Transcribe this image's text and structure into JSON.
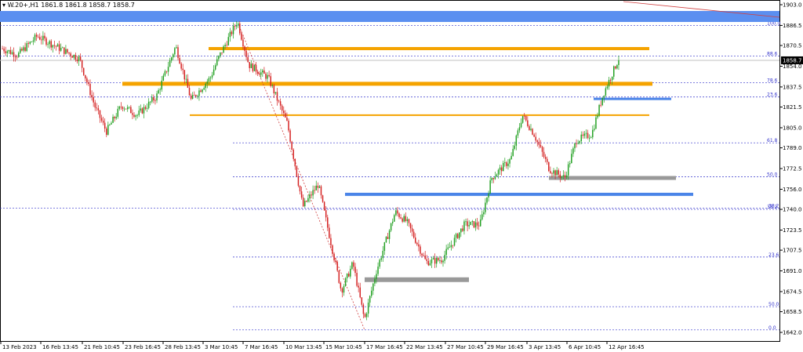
{
  "header": {
    "symbol": "W.20+,H1",
    "ohlc": "1861.8 1861.8 1858.7 1858.7"
  },
  "chart_data": {
    "type": "candlestick",
    "ylim": [
      1642.0,
      1903.0
    ],
    "price_ticks": [
      1903.0,
      1886.5,
      1870.5,
      1854.0,
      1837.5,
      1821.5,
      1805.0,
      1789.0,
      1772.5,
      1756.0,
      1740.0,
      1723.5,
      1707.5,
      1691.0,
      1674.5,
      1658.5,
      1642.0
    ],
    "time_labels": [
      "13 Feb 2023",
      "16 Feb 13:45",
      "21 Feb 10:45",
      "23 Feb 16:45",
      "28 Feb 13:45",
      "3 Mar 10:45",
      "7 Mar 16:45",
      "10 Mar 13:45",
      "15 Mar 10:45",
      "17 Mar 16:45",
      "22 Mar 13:45",
      "27 Mar 10:45",
      "29 Mar 16:45",
      "3 Apr 13:45",
      "6 Apr 10:45",
      "12 Apr 16:45"
    ],
    "current_price": "1858.7",
    "fib_levels_1": [
      "100.0",
      "88.6",
      "78.6",
      "23.6",
      "61.8",
      "50.0",
      "38.2"
    ],
    "fib_levels_2": [
      "38.2",
      "23.6",
      "50.0",
      "0.0"
    ],
    "path": [
      {
        "t": 0,
        "p": 1868
      },
      {
        "t": 0.02,
        "p": 1863
      },
      {
        "t": 0.045,
        "p": 1878
      },
      {
        "t": 0.075,
        "p": 1868
      },
      {
        "t": 0.1,
        "p": 1860
      },
      {
        "t": 0.12,
        "p": 1822
      },
      {
        "t": 0.135,
        "p": 1802
      },
      {
        "t": 0.155,
        "p": 1823
      },
      {
        "t": 0.175,
        "p": 1815
      },
      {
        "t": 0.2,
        "p": 1830
      },
      {
        "t": 0.225,
        "p": 1870
      },
      {
        "t": 0.245,
        "p": 1827
      },
      {
        "t": 0.27,
        "p": 1845
      },
      {
        "t": 0.28,
        "p": 1860
      },
      {
        "t": 0.305,
        "p": 1890
      },
      {
        "t": 0.32,
        "p": 1855
      },
      {
        "t": 0.345,
        "p": 1845
      },
      {
        "t": 0.37,
        "p": 1808
      },
      {
        "t": 0.39,
        "p": 1742
      },
      {
        "t": 0.41,
        "p": 1760
      },
      {
        "t": 0.44,
        "p": 1675
      },
      {
        "t": 0.455,
        "p": 1697
      },
      {
        "t": 0.47,
        "p": 1652
      },
      {
        "t": 0.485,
        "p": 1690
      },
      {
        "t": 0.51,
        "p": 1738
      },
      {
        "t": 0.525,
        "p": 1730
      },
      {
        "t": 0.55,
        "p": 1698
      },
      {
        "t": 0.57,
        "p": 1700
      },
      {
        "t": 0.6,
        "p": 1728
      },
      {
        "t": 0.62,
        "p": 1728
      },
      {
        "t": 0.635,
        "p": 1765
      },
      {
        "t": 0.66,
        "p": 1780
      },
      {
        "t": 0.675,
        "p": 1815
      },
      {
        "t": 0.69,
        "p": 1800
      },
      {
        "t": 0.71,
        "p": 1772
      },
      {
        "t": 0.73,
        "p": 1765
      },
      {
        "t": 0.745,
        "p": 1795
      },
      {
        "t": 0.765,
        "p": 1800
      },
      {
        "t": 0.78,
        "p": 1832
      },
      {
        "t": 0.8,
        "p": 1860
      }
    ]
  }
}
